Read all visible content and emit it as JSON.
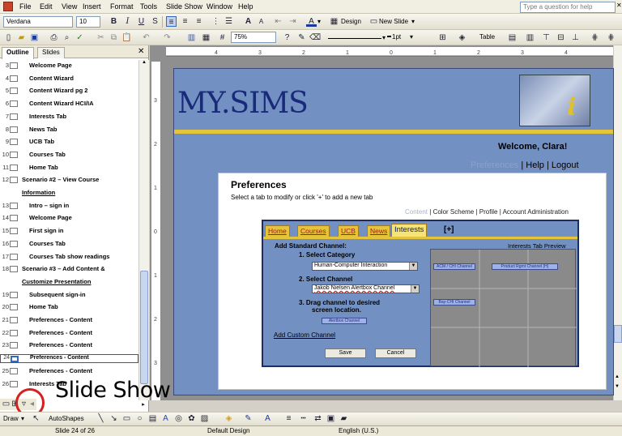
{
  "menu": {
    "items": [
      "File",
      "Edit",
      "View",
      "Insert",
      "Format",
      "Tools",
      "Slide Show",
      "Window",
      "Help"
    ],
    "help_placeholder": "Type a question for help"
  },
  "formatting": {
    "font": "Verdana",
    "size": "10",
    "design_label": "Design",
    "new_slide_label": "New Slide"
  },
  "standard": {
    "zoom": "75%",
    "line_weight": "1pt",
    "table_label": "Table"
  },
  "pane_tabs": [
    "Outline",
    "Slides"
  ],
  "outline": [
    {
      "num": "3",
      "text": "Welcome Page",
      "type": "slide"
    },
    {
      "num": "4",
      "text": "Content Wizard",
      "type": "slide"
    },
    {
      "num": "5",
      "text": "Content Wizard pg 2",
      "type": "slide"
    },
    {
      "num": "6",
      "text": "Content Wizard HCI/IA",
      "type": "slide"
    },
    {
      "num": "7",
      "text": "Interests Tab",
      "type": "slide"
    },
    {
      "num": "8",
      "text": "News Tab",
      "type": "slide"
    },
    {
      "num": "9",
      "text": "UCB Tab",
      "type": "slide"
    },
    {
      "num": "10",
      "text": "Courses Tab",
      "type": "slide"
    },
    {
      "num": "11",
      "text": "Home Tab",
      "type": "slide"
    },
    {
      "num": "12",
      "text": "Scenario #2 – View Course",
      "type": "scenario"
    },
    {
      "num": "",
      "text": "Information",
      "type": "scenario-cont"
    },
    {
      "num": "13",
      "text": "Intro – sign in",
      "type": "slide"
    },
    {
      "num": "14",
      "text": "Welcome Page",
      "type": "slide"
    },
    {
      "num": "15",
      "text": "First sign in",
      "type": "slide"
    },
    {
      "num": "16",
      "text": "Courses Tab",
      "type": "slide"
    },
    {
      "num": "17",
      "text": "Courses Tab show readings",
      "type": "slide"
    },
    {
      "num": "18",
      "text": "Scenario #3 – Add Content &",
      "type": "scenario"
    },
    {
      "num": "",
      "text": "Customize Presentation",
      "type": "scenario-cont"
    },
    {
      "num": "19",
      "text": "Subsequent sign-in",
      "type": "slide"
    },
    {
      "num": "20",
      "text": "Home Tab",
      "type": "slide"
    },
    {
      "num": "21",
      "text": "Preferences - Content",
      "type": "slide"
    },
    {
      "num": "22",
      "text": "Preferences - Content",
      "type": "slide"
    },
    {
      "num": "23",
      "text": "Preferences - Content",
      "type": "slide"
    },
    {
      "num": "24",
      "text": "Preferences - Content",
      "type": "slide",
      "selected": true
    },
    {
      "num": "25",
      "text": "Preferences - Content",
      "type": "slide"
    },
    {
      "num": "26",
      "text": "Interests Tab",
      "type": "slide"
    }
  ],
  "slide": {
    "logo": "MY.SIMS",
    "welcome": "Welcome, Clara!",
    "top_links": {
      "preferences": "Preferences",
      "help": "Help",
      "logout": "Logout"
    },
    "panel_title": "Preferences",
    "panel_sub": "Select a tab to modify or click '+' to add a new tab",
    "panel_links": {
      "content": "Content",
      "color": "Color Scheme",
      "profile": "Profile",
      "account": "Account Administration"
    },
    "tabs": [
      "Home",
      "Courses",
      "UCB",
      "News",
      "Interests"
    ],
    "plus": "[+]",
    "add_std": "Add Standard Channel:",
    "preview": "Interests Tab Preview",
    "step1": "1.  Select Category",
    "category": "Human-Computer Interaction",
    "step2": "2.  Select Channel",
    "channel": "Jakob Nielsen Alertbox Channel",
    "step3a": "3.  Drag channel to desired",
    "step3b": "screen location.",
    "drag_chip": "Alertbox Channel",
    "add_custom": "Add Custom Channel",
    "save": "Save",
    "cancel": "Cancel",
    "grid_chips": [
      "ACM / CHI Channel",
      "Product Rgmt Channel (H)",
      "Bay-CHI Channel"
    ]
  },
  "drawing": {
    "draw_label": "Draw",
    "autoshapes_label": "AutoShapes"
  },
  "status": {
    "slide": "Slide 24 of 26",
    "design": "Default Design",
    "language": "English (U.S.)"
  },
  "callout": "Slide Show"
}
